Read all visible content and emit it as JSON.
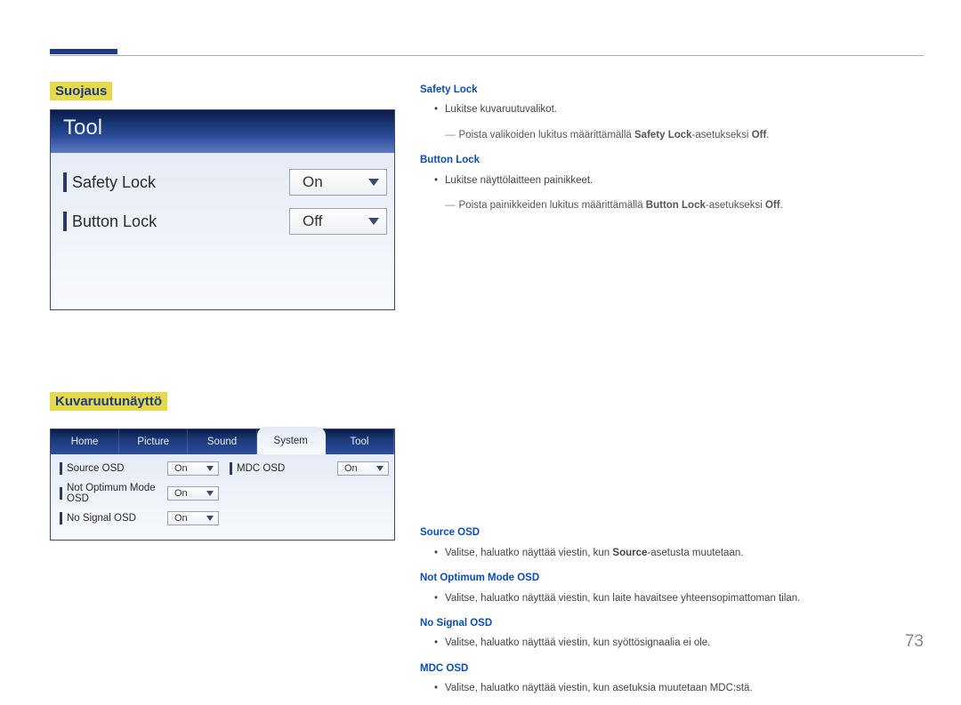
{
  "page_number": "73",
  "section1": {
    "heading": "Suojaus",
    "safety_lock": {
      "title": "Safety Lock",
      "bullet": "Lukitse kuvaruutuvalikot.",
      "note_prefix": "Poista valikoiden lukitus määrittämällä ",
      "note_bold": "Safety Lock",
      "note_mid": "-asetukseksi ",
      "note_off": "Off",
      "note_end": "."
    },
    "button_lock": {
      "title": "Button Lock",
      "bullet": "Lukitse näyttölaitteen painikkeet.",
      "note_prefix": "Poista painikkeiden lukitus määrittämällä ",
      "note_bold": "Button Lock",
      "note_mid": "-asetukseksi ",
      "note_off": "Off",
      "note_end": "."
    },
    "panel": {
      "header": "Tool",
      "rows": [
        {
          "label": "Safety Lock",
          "value": "On"
        },
        {
          "label": "Button Lock",
          "value": "Off"
        }
      ]
    }
  },
  "section2": {
    "heading": "Kuvaruutunäyttö",
    "source_osd": {
      "title": "Source OSD",
      "bullet_pre": "Valitse, haluatko näyttää viestin, kun ",
      "bullet_bold": "Source",
      "bullet_post": "-asetusta muutetaan."
    },
    "not_optimum": {
      "title": "Not Optimum Mode OSD",
      "bullet": "Valitse, haluatko näyttää viestin, kun laite havaitsee yhteensopimattoman tilan."
    },
    "no_signal": {
      "title": "No Signal OSD",
      "bullet": "Valitse, haluatko näyttää viestin, kun syöttösignaalia ei ole."
    },
    "mdc_osd": {
      "title": "MDC OSD",
      "bullet": "Valitse, haluatko näyttää viestin, kun asetuksia muutetaan MDC:stä."
    },
    "panel": {
      "tabs": [
        "Home",
        "Picture",
        "Sound",
        "System",
        "Tool"
      ],
      "active_tab_index": 3,
      "left_rows": [
        {
          "label": "Source OSD",
          "value": "On"
        },
        {
          "label": "Not Optimum Mode OSD",
          "value": "On"
        },
        {
          "label": "No Signal OSD",
          "value": "On"
        }
      ],
      "right_rows": [
        {
          "label": "MDC OSD",
          "value": "On"
        }
      ]
    }
  }
}
